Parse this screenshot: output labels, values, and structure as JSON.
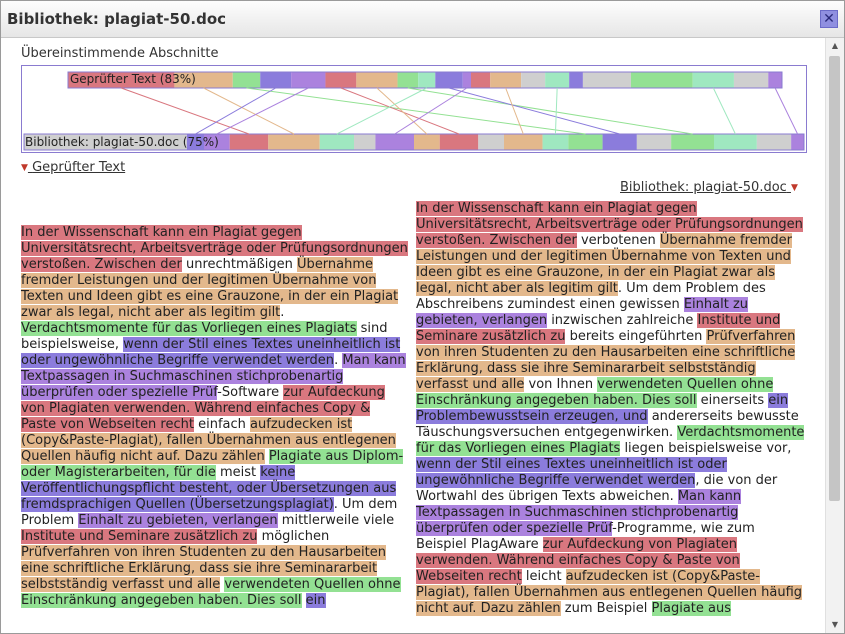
{
  "window": {
    "title": "Bibliothek: plagiat-50.doc",
    "close_label": "✕"
  },
  "overview": {
    "section_title": "Übereinstimmende Abschnitte",
    "top_label": "Geprüfter Text (83%)",
    "bottom_label": "Bibliothek: plagiat-50.doc (75%)"
  },
  "toggles": {
    "left": "Geprüfter Text",
    "right": "Bibliothek: plagiat-50.doc"
  },
  "colors": {
    "red": "#d9777f",
    "orange": "#e3b88c",
    "green": "#93e193",
    "violet": "#8b7cdc",
    "purple": "#ab82de",
    "mint": "#9fe8c0",
    "gray": "#cfcfcf"
  },
  "left_segments": [
    {
      "c": "red",
      "t": "In der Wissenschaft kann ein Plagiat gegen Universitätsrecht, Arbeitsverträge oder Prüfungsordnungen verstoßen. Zwischen der"
    },
    {
      "c": "none",
      "t": " unrechtmäßigen "
    },
    {
      "c": "orange",
      "t": "Übernahme fremder Leistungen und der legitimen Übernahme von Texten und Ideen gibt es eine Grauzone, in der ein Plagiat zwar als legal, nicht aber als legitim gilt"
    },
    {
      "c": "none",
      "t": ". "
    },
    {
      "c": "green",
      "t": "Verdachtsmomente für das Vorliegen eines Plagiats"
    },
    {
      "c": "none",
      "t": " sind beispielsweise, "
    },
    {
      "c": "violet",
      "t": "wenn der Stil eines Textes uneinheitlich ist oder ungewöhnliche Begriffe verwendet werden"
    },
    {
      "c": "none",
      "t": ". "
    },
    {
      "c": "purple",
      "t": "Man kann Textpassagen in Suchmaschinen stichprobenartig überprüfen oder spezielle Prüf"
    },
    {
      "c": "none",
      "t": "-Software "
    },
    {
      "c": "red",
      "t": "zur Aufdeckung von Plagiaten verwenden. Während einfaches Copy & Paste von Webseiten recht"
    },
    {
      "c": "none",
      "t": " einfach "
    },
    {
      "c": "orange",
      "t": "aufzudecken ist (Copy&Paste-Plagiat), fallen Übernahmen aus entlegenen Quellen häufig nicht auf. Dazu zählen"
    },
    {
      "c": "none",
      "t": " "
    },
    {
      "c": "green",
      "t": "Plagiate aus Diplom- oder Magisterarbeiten, für die"
    },
    {
      "c": "none",
      "t": " meist "
    },
    {
      "c": "violet",
      "t": "keine Veröffentlichungspflicht besteht, oder Übersetzungen aus fremdsprachigen Quellen (Übersetzungsplagiat)"
    },
    {
      "c": "none",
      "t": ". Um dem Problem "
    },
    {
      "c": "purple",
      "t": "Einhalt zu gebieten, verlangen"
    },
    {
      "c": "none",
      "t": " mittlerweile viele "
    },
    {
      "c": "red",
      "t": "Institute und Seminare zusätzlich zu"
    },
    {
      "c": "none",
      "t": " möglichen "
    },
    {
      "c": "orange",
      "t": "Prüfverfahren von ihren Studenten zu den Hausarbeiten eine schriftliche Erklärung, dass sie ihre Seminararbeit selbstständig verfasst und alle"
    },
    {
      "c": "none",
      "t": " "
    },
    {
      "c": "green",
      "t": "verwendeten Quellen ohne Einschränkung angegeben haben. Dies soll"
    },
    {
      "c": "none",
      "t": " "
    },
    {
      "c": "violet",
      "t": "ein"
    }
  ],
  "right_segments": [
    {
      "c": "red",
      "t": "In der Wissenschaft kann ein Plagiat gegen Universitätsrecht, Arbeitsverträge oder Prüfungsordnungen verstoßen. Zwischen der"
    },
    {
      "c": "none",
      "t": " verbotenen "
    },
    {
      "c": "orange",
      "t": "Übernahme fremder Leistungen und der legitimen Übernahme von Texten und Ideen gibt es eine Grauzone, in der ein Plagiat zwar als legal, nicht aber als legitim gilt"
    },
    {
      "c": "none",
      "t": ". Um dem Problem des Abschreibens zumindest einen gewissen "
    },
    {
      "c": "purple",
      "t": "Einhalt zu gebieten, verlangen"
    },
    {
      "c": "none",
      "t": " inzwischen zahlreiche "
    },
    {
      "c": "red",
      "t": "Institute und Seminare zusätzlich zu"
    },
    {
      "c": "none",
      "t": " bereits eingeführten "
    },
    {
      "c": "orange",
      "t": "Prüfverfahren von ihren Studenten zu den Hausarbeiten eine schriftliche Erklärung, dass sie ihre Seminararbeit selbstständig verfasst und alle"
    },
    {
      "c": "none",
      "t": " von Ihnen "
    },
    {
      "c": "green",
      "t": "verwendeten Quellen ohne Einschränkung angegeben haben. Dies soll"
    },
    {
      "c": "none",
      "t": " einerseits "
    },
    {
      "c": "violet",
      "t": "ein Problembewusstsein erzeugen, und"
    },
    {
      "c": "none",
      "t": " andererseits bewusste Täuschungsversuchen entgegenwirken. "
    },
    {
      "c": "green",
      "t": "Verdachtsmomente für das Vorliegen eines Plagiats"
    },
    {
      "c": "none",
      "t": " liegen beispielsweise vor, "
    },
    {
      "c": "violet",
      "t": "wenn der Stil eines Textes uneinheitlich ist oder ungewöhnliche Begriffe verwendet werden"
    },
    {
      "c": "none",
      "t": ", die von der Wortwahl des übrigen Texts abweichen. "
    },
    {
      "c": "purple",
      "t": "Man kann Textpassagen in Suchmaschinen stichprobenartig überprüfen oder spezielle Prüf"
    },
    {
      "c": "none",
      "t": "-Programme, wie zum Beispiel PlagAware "
    },
    {
      "c": "red",
      "t": "zur Aufdeckung von Plagiaten verwenden. Während einfaches Copy & Paste von Webseiten recht"
    },
    {
      "c": "none",
      "t": " leicht "
    },
    {
      "c": "orange",
      "t": "aufzudecken ist (Copy&Paste-Plagiat), fallen Übernahmen aus entlegenen Quellen häufig nicht auf. Dazu zählen"
    },
    {
      "c": "none",
      "t": " zum Beispiel "
    },
    {
      "c": "green",
      "t": "Plagiate aus"
    }
  ],
  "top_bar": [
    [
      "red",
      0.155
    ],
    [
      "orange",
      0.085
    ],
    [
      "green",
      0.04
    ],
    [
      "violet",
      0.045
    ],
    [
      "purple",
      0.05
    ],
    [
      "red",
      0.045
    ],
    [
      "orange",
      0.06
    ],
    [
      "green",
      0.03
    ],
    [
      "mint",
      0.025
    ],
    [
      "violet",
      0.04
    ],
    [
      "purple",
      0.012
    ],
    [
      "red",
      0.028
    ],
    [
      "orange",
      0.045
    ],
    [
      "gray",
      0.035
    ],
    [
      "mint",
      0.035
    ],
    [
      "violet",
      0.02
    ],
    [
      "gray",
      0.07
    ],
    [
      "green",
      0.09
    ],
    [
      "mint",
      0.06
    ],
    [
      "gray",
      0.05
    ],
    [
      "purple",
      0.02
    ]
  ],
  "bottom_bar": [
    [
      "gray",
      0.19
    ],
    [
      "violet",
      0.02
    ],
    [
      "purple",
      0.03
    ],
    [
      "red",
      0.045
    ],
    [
      "orange",
      0.06
    ],
    [
      "mint",
      0.04
    ],
    [
      "gray",
      0.025
    ],
    [
      "purple",
      0.045
    ],
    [
      "orange",
      0.03
    ],
    [
      "red",
      0.045
    ],
    [
      "gray",
      0.03
    ],
    [
      "orange",
      0.045
    ],
    [
      "mint",
      0.03
    ],
    [
      "green",
      0.04
    ],
    [
      "violet",
      0.04
    ],
    [
      "gray",
      0.04
    ],
    [
      "green",
      0.05
    ],
    [
      "mint",
      0.05
    ],
    [
      "gray",
      0.04
    ],
    [
      "purple",
      0.015
    ]
  ]
}
